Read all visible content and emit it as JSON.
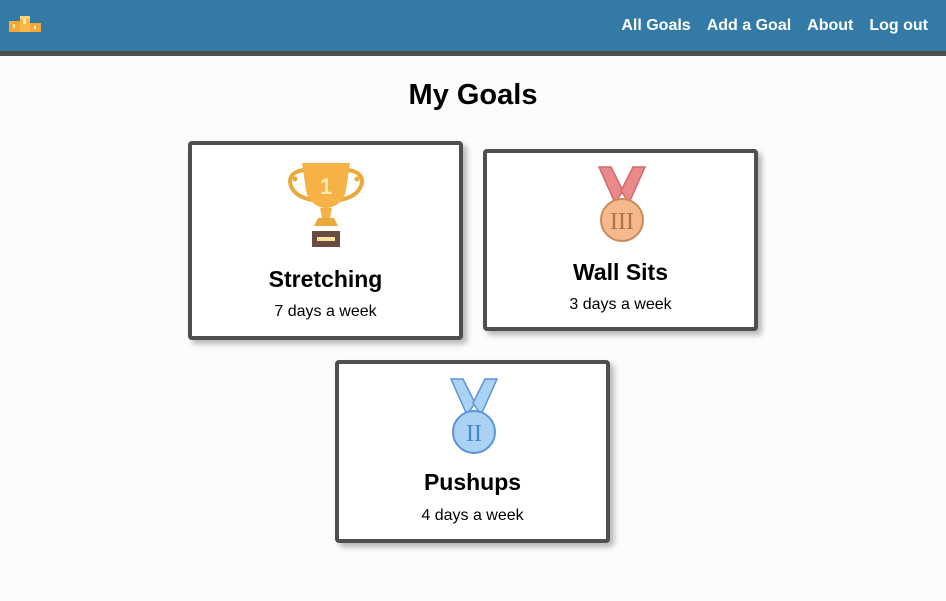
{
  "navbar": {
    "brand_color": "#337ba6",
    "logo_icon": "podium-icon",
    "links": [
      {
        "label": "All Goals"
      },
      {
        "label": "Add a Goal"
      },
      {
        "label": "About"
      },
      {
        "label": "Log out"
      }
    ]
  },
  "main": {
    "title": "My Goals",
    "goals": [
      {
        "name": "Stretching",
        "frequency": "7 days a week",
        "award_icon": "trophy-icon",
        "trophy_number": "1"
      },
      {
        "name": "Wall Sits",
        "frequency": "3 days a week",
        "award_icon": "bronze-medal-icon",
        "medal_numeral": "III"
      },
      {
        "name": "Pushups",
        "frequency": "4 days a week",
        "award_icon": "silver-medal-icon",
        "medal_numeral": "II"
      }
    ]
  }
}
